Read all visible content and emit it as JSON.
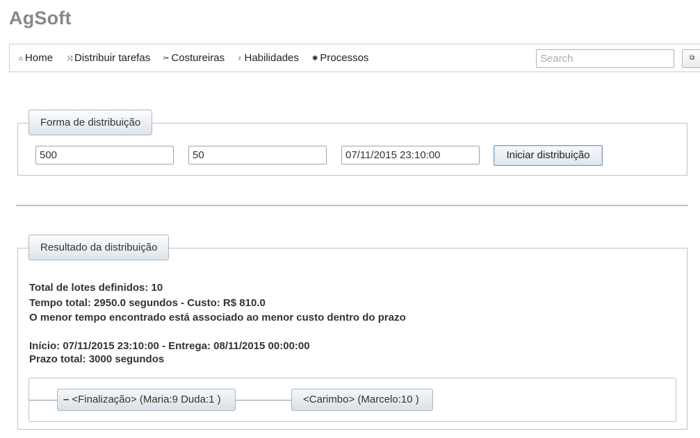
{
  "app": {
    "brand": "AgSoft"
  },
  "nav": {
    "items": [
      {
        "label": "Home",
        "icon": "home-icon",
        "glyph": "⌂"
      },
      {
        "label": "Distribuir tarefas",
        "icon": "shuffle-icon",
        "glyph": "⤨"
      },
      {
        "label": "Costureiras",
        "icon": "scissors-icon",
        "glyph": "✂"
      },
      {
        "label": "Habilidades",
        "icon": "lightbulb-icon",
        "glyph": "♀"
      },
      {
        "label": "Processos",
        "icon": "gear-icon",
        "glyph": "✱"
      }
    ],
    "search_placeholder": "Search",
    "external_glyph": "⧉"
  },
  "distribution_form": {
    "legend": "Forma de distribuição",
    "field1_value": "500",
    "field2_value": "50",
    "field3_value": "07/11/2015 23:10:00",
    "start_button": "Iniciar distribuição"
  },
  "result": {
    "legend": "Resultado da distribuição",
    "lines": [
      "Total de lotes definidos: 10",
      "Tempo total: 2950.0 segundos - Custo: R$ 810.0",
      "O menor tempo encontrado está associado ao menor custo dentro do prazo",
      "Início: 07/11/2015 23:10:00 - Entrega: 08/11/2015 00:00:00",
      "Prazo total: 3000 segundos"
    ],
    "tree": {
      "toggle": "–",
      "node1": "<Finalização> (Maria:9 Duda:1 )",
      "node2": "<Carimbo> (Marcelo:10 )"
    }
  },
  "colors": {
    "accent_border": "#7a9cc4",
    "panel_border": "#b8c4cc",
    "brand_text": "#888888"
  }
}
